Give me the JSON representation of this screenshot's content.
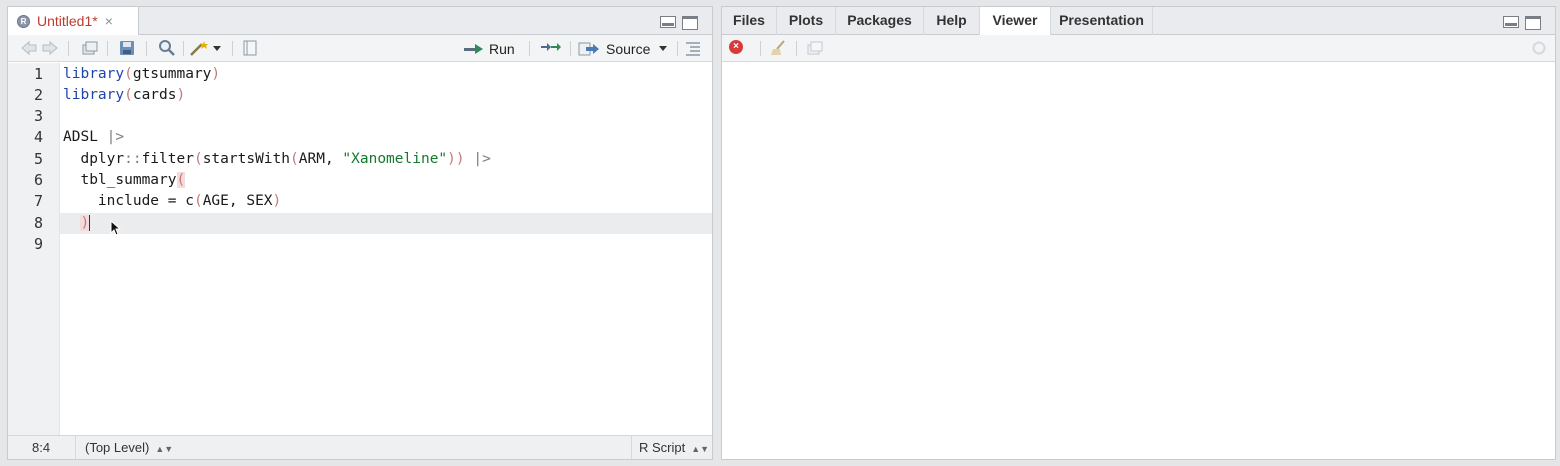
{
  "editor": {
    "tab_title": "Untitled1*",
    "tab_close": "×",
    "r_logo": "R",
    "toolbar": {
      "run_label": "Run",
      "source_label": "Source"
    },
    "lines": [
      {
        "num": "1"
      },
      {
        "num": "2"
      },
      {
        "num": "3"
      },
      {
        "num": "4"
      },
      {
        "num": "5"
      },
      {
        "num": "6"
      },
      {
        "num": "7"
      },
      {
        "num": "8"
      },
      {
        "num": "9"
      }
    ],
    "code": {
      "l1_fn": "library",
      "l1_open": "(",
      "l1_arg": "gtsummary",
      "l1_close": ")",
      "l2_fn": "library",
      "l2_open": "(",
      "l2_arg": "cards",
      "l2_close": ")",
      "l4_obj": "ADSL ",
      "l4_pipe": "|>",
      "l5_ns": "  dplyr",
      "l5_colons": "::",
      "l5_fn": "filter",
      "l5_open": "(",
      "l5_fn2": "startsWith",
      "l5_open2": "(",
      "l5_args": "ARM, ",
      "l5_str": "\"Xanomeline\"",
      "l5_close": "))",
      "l5_pipe": " |>",
      "l6_fn": "  tbl_summary",
      "l6_open": "(",
      "l7_arg": "    include = c",
      "l7_open": "(",
      "l7_args": "AGE, SEX",
      "l7_close": ")",
      "l8_indent": "  ",
      "l8_close": ")"
    },
    "status": {
      "position": "8:4",
      "scope": "(Top Level)",
      "file_type": "R Script"
    }
  },
  "viewer": {
    "tabs": [
      {
        "label": "Files"
      },
      {
        "label": "Plots"
      },
      {
        "label": "Packages"
      },
      {
        "label": "Help"
      },
      {
        "label": "Viewer"
      },
      {
        "label": "Presentation"
      }
    ],
    "active_tab": "Viewer",
    "stop_icon_text": "×"
  },
  "colors": {
    "keyword": "#1e46aa",
    "string": "#147a2e",
    "paren": "#c77a7a",
    "tab_title": "#c0392b"
  }
}
